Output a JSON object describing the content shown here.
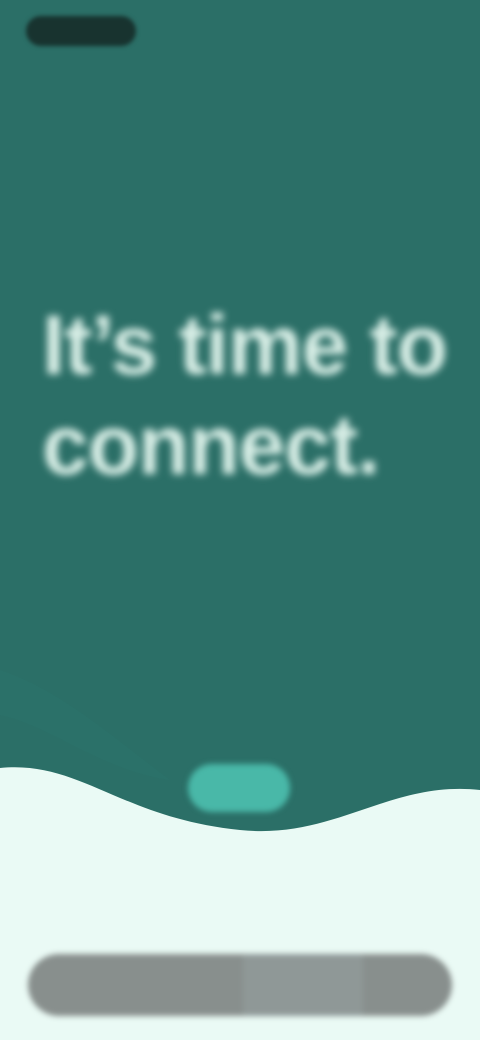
{
  "app": {
    "brand_color": "#2a7068",
    "accent_color": "#49b8a8",
    "background_color": "#eafaf5"
  },
  "header": {
    "logo_icon": "brand-logo-icon",
    "top_link": ""
  },
  "hero": {
    "headline": "It’s time to connect."
  },
  "cta": {
    "label": ""
  },
  "bottom_bar": {
    "label": ""
  }
}
